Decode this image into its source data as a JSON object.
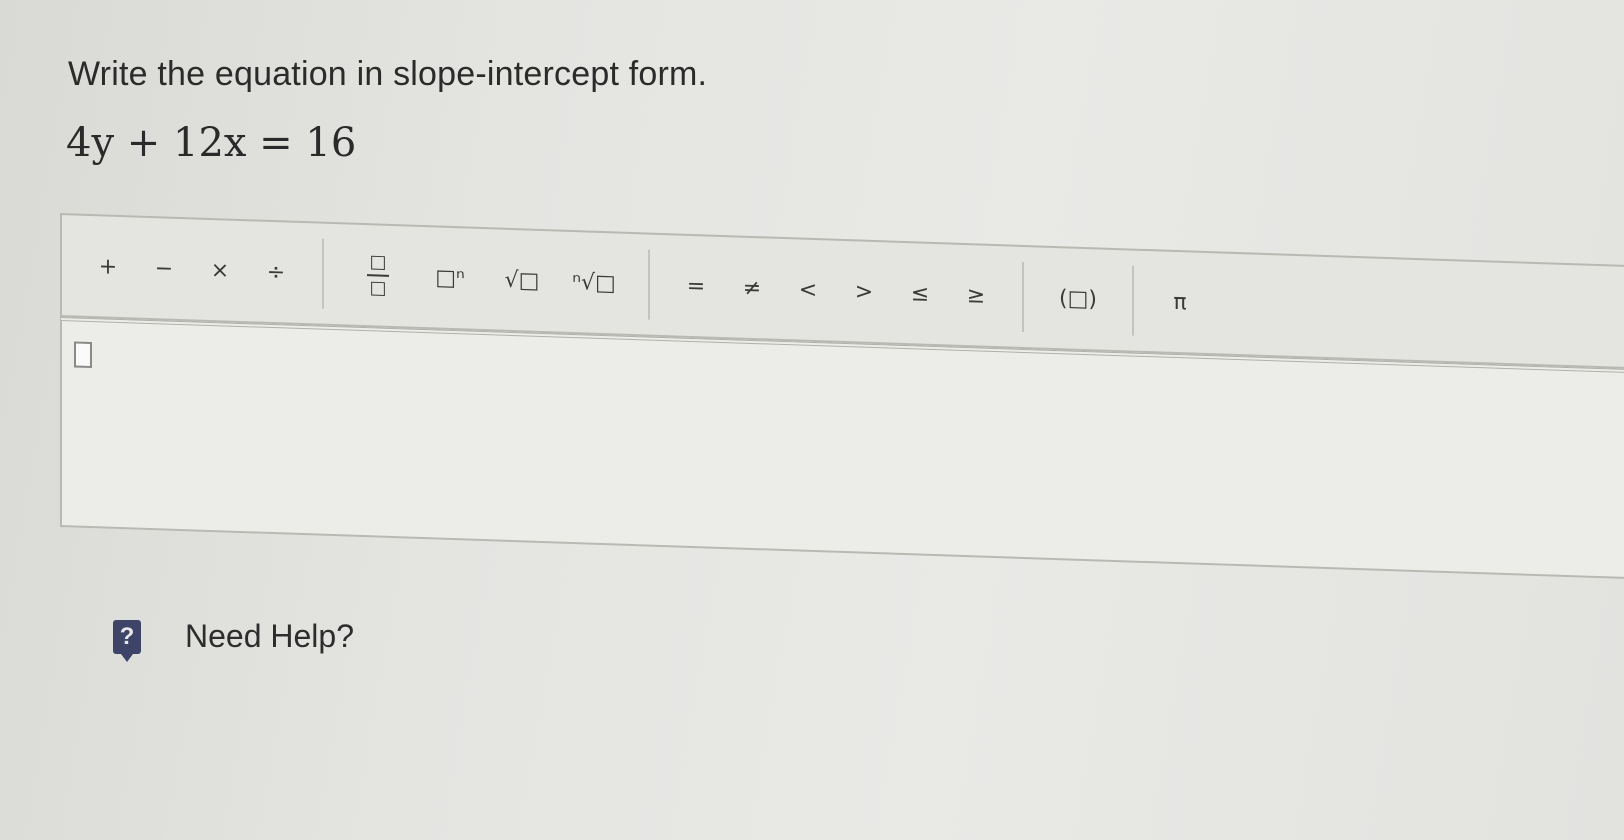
{
  "question": {
    "instruction": "Write the equation in slope-intercept form.",
    "equation": "4y + 12x = 16"
  },
  "toolbar": {
    "groups": [
      {
        "name": "operators",
        "buttons": [
          {
            "id": "plus",
            "label": "+"
          },
          {
            "id": "minus",
            "label": "−"
          },
          {
            "id": "times",
            "label": "×"
          },
          {
            "id": "divide",
            "label": "÷"
          }
        ]
      },
      {
        "name": "templates",
        "buttons": [
          {
            "id": "fraction",
            "label_num": "□",
            "label_den": "□"
          },
          {
            "id": "exponent",
            "label": "□ⁿ"
          },
          {
            "id": "sqrt",
            "label": "√□"
          },
          {
            "id": "nthroot",
            "label": "ⁿ√□"
          }
        ]
      },
      {
        "name": "relations",
        "buttons": [
          {
            "id": "equals",
            "label": "="
          },
          {
            "id": "notequal",
            "label": "≠"
          },
          {
            "id": "lessthan",
            "label": "<"
          },
          {
            "id": "greaterthan",
            "label": ">"
          },
          {
            "id": "lessequal",
            "label": "≤"
          },
          {
            "id": "greaterequal",
            "label": "≥"
          }
        ]
      },
      {
        "name": "grouping",
        "buttons": [
          {
            "id": "parentheses",
            "label": "(□)"
          }
        ]
      },
      {
        "name": "constants",
        "buttons": [
          {
            "id": "pi",
            "label": "π"
          }
        ]
      }
    ]
  },
  "answer": {
    "value": ""
  },
  "help": {
    "icon_label": "?",
    "label": "Need Help?"
  }
}
